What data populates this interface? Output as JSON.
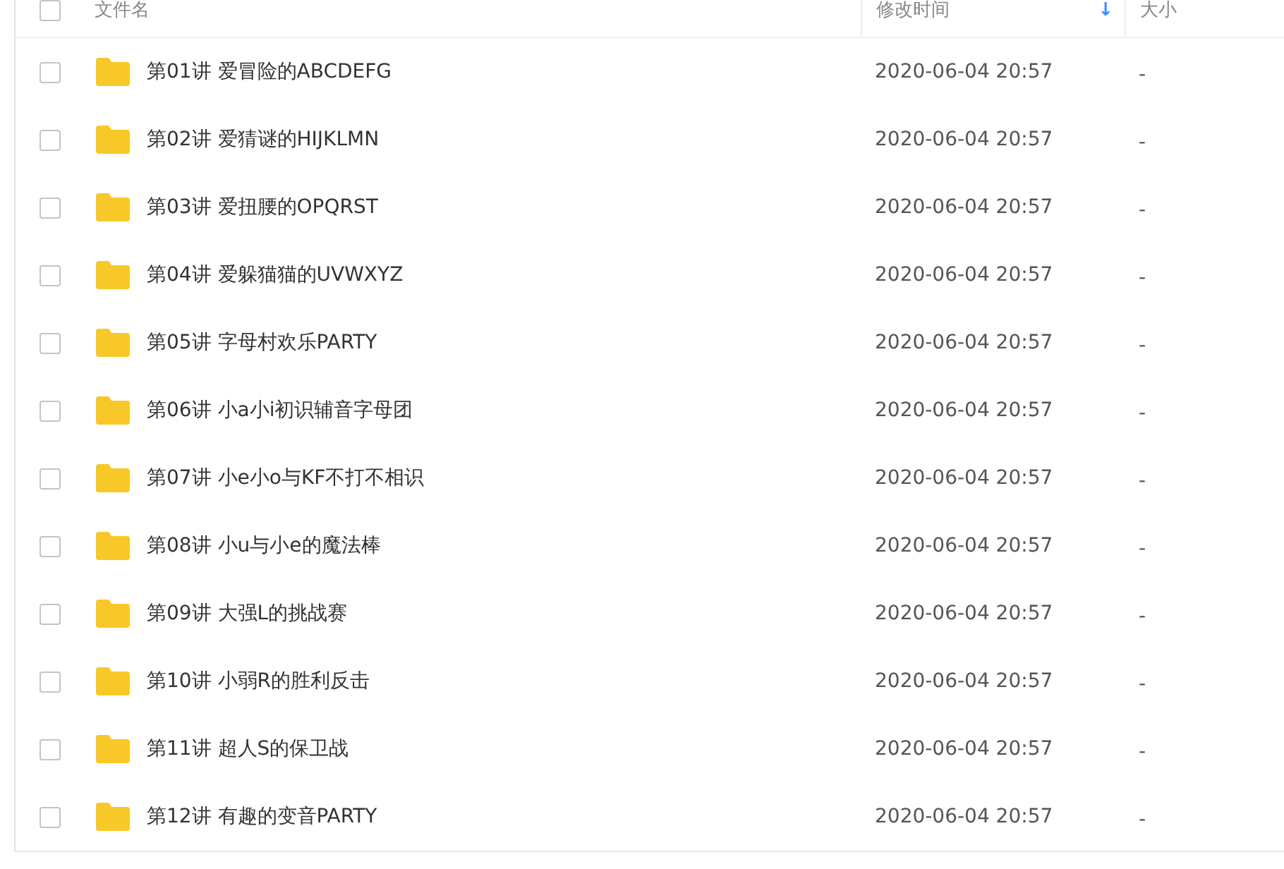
{
  "header": {
    "checked": false,
    "name": "文件名",
    "modified": "修改时间",
    "sort_arrow": "↓",
    "size": "大小"
  },
  "rows": [
    {
      "name": "第01讲 爱冒险的ABCDEFG",
      "modified": "2020-06-04 20:57",
      "size": "-",
      "checked": false
    },
    {
      "name": "第02讲 爱猜谜的HIJKLMN",
      "modified": "2020-06-04 20:57",
      "size": "-",
      "checked": false
    },
    {
      "name": "第03讲 爱扭腰的OPQRST",
      "modified": "2020-06-04 20:57",
      "size": "-",
      "checked": false
    },
    {
      "name": "第04讲 爱躲猫猫的UVWXYZ",
      "modified": "2020-06-04 20:57",
      "size": "-",
      "checked": false
    },
    {
      "name": "第05讲 字母村欢乐PARTY",
      "modified": "2020-06-04 20:57",
      "size": "-",
      "checked": false
    },
    {
      "name": "第06讲 小a小i初识辅音字母团",
      "modified": "2020-06-04 20:57",
      "size": "-",
      "checked": false
    },
    {
      "name": "第07讲 小e小o与KF不打不相识",
      "modified": "2020-06-04 20:57",
      "size": "-",
      "checked": false
    },
    {
      "name": "第08讲 小u与小e的魔法棒",
      "modified": "2020-06-04 20:57",
      "size": "-",
      "checked": false
    },
    {
      "name": "第09讲 大强L的挑战赛",
      "modified": "2020-06-04 20:57",
      "size": "-",
      "checked": false
    },
    {
      "name": "第10讲 小弱R的胜利反击",
      "modified": "2020-06-04 20:57",
      "size": "-",
      "checked": false
    },
    {
      "name": "第11讲 超人S的保卫战",
      "modified": "2020-06-04 20:57",
      "size": "-",
      "checked": false
    },
    {
      "name": "第12讲 有趣的变音PARTY",
      "modified": "2020-06-04 20:57",
      "size": "-",
      "checked": false
    }
  ]
}
